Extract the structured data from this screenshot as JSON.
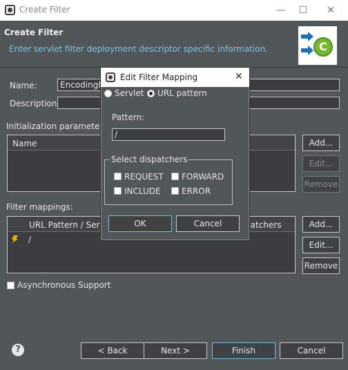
{
  "window": {
    "title": "Create Filter",
    "minimize_glyph": "—",
    "maximize_glyph": "☐",
    "close_glyph": "✕"
  },
  "header": {
    "title": "Create Filter",
    "subtitle": "Enter servlet filter deployment descriptor specific information."
  },
  "form": {
    "name_label": "Name:",
    "name_value": "EncodingF",
    "description_label": "Description:",
    "description_value": "",
    "init_params_label": "Initialization parameters:",
    "init_params_columns": [
      "Name"
    ],
    "init_buttons": [
      "Add...",
      "Edit...",
      "Remove"
    ],
    "filter_mappings_label": "Filter mappings:",
    "mapping_columns": [
      "URL Pattern / Servl",
      "patchers"
    ],
    "mapping_rows": [
      {
        "pattern": "/"
      }
    ],
    "mapping_buttons": [
      "Add...",
      "Edit...",
      "Remove"
    ],
    "async_label": "Asynchronous Support"
  },
  "footer": {
    "help": "?",
    "back": "< Back",
    "next": "Next >",
    "finish": "Finish",
    "cancel": "Cancel"
  },
  "dialog": {
    "title": "Edit Filter Mapping",
    "close_glyph": "✕",
    "radio_servlet": "Servlet",
    "radio_url": "URL pattern",
    "pattern_label": "Pattern:",
    "pattern_value": "/",
    "dispatchers_label": "Select dispatchers",
    "dispatchers": [
      "REQUEST",
      "FORWARD",
      "INCLUDE",
      "ERROR"
    ],
    "ok": "OK",
    "cancel": "Cancel"
  }
}
